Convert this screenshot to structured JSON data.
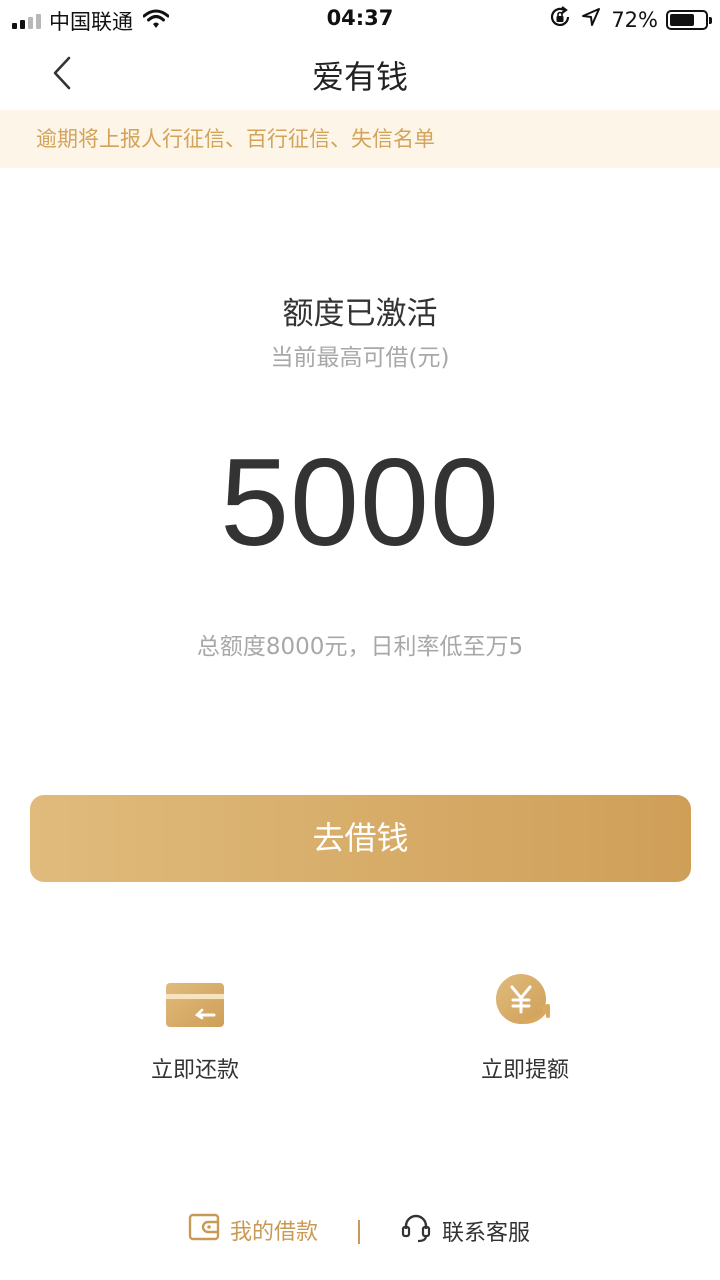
{
  "status_bar": {
    "carrier": "中国联通",
    "time": "04:37",
    "battery_percent": "72%",
    "battery_level": 0.72,
    "icons": [
      "signal-icon",
      "wifi-icon",
      "orientation-lock-icon",
      "location-arrow-icon",
      "battery-icon"
    ]
  },
  "nav": {
    "title": "爱有钱",
    "back_icon": "chevron-left-icon"
  },
  "notice": {
    "text": "逾期将上报人行征信、百行征信、失信名单"
  },
  "credit": {
    "status": "额度已激活",
    "subtitle": "当前最高可借(元)",
    "amount": "5000",
    "description": "总额度8000元，日利率低至万5"
  },
  "primary_action": {
    "label": "去借钱"
  },
  "quick_actions": [
    {
      "label": "立即还款",
      "icon": "card-repay-icon"
    },
    {
      "label": "立即提额",
      "icon": "yen-increase-icon"
    }
  ],
  "footer": {
    "my_loans": "我的借款",
    "contact_service": "联系客服"
  },
  "colors": {
    "accent": "#cf9f58",
    "accent_light": "#e0bb7c",
    "notice_bg": "#fdf6e8",
    "notice_text": "#d4a35a",
    "text_primary": "#333333",
    "text_secondary": "#a8a8a8"
  }
}
